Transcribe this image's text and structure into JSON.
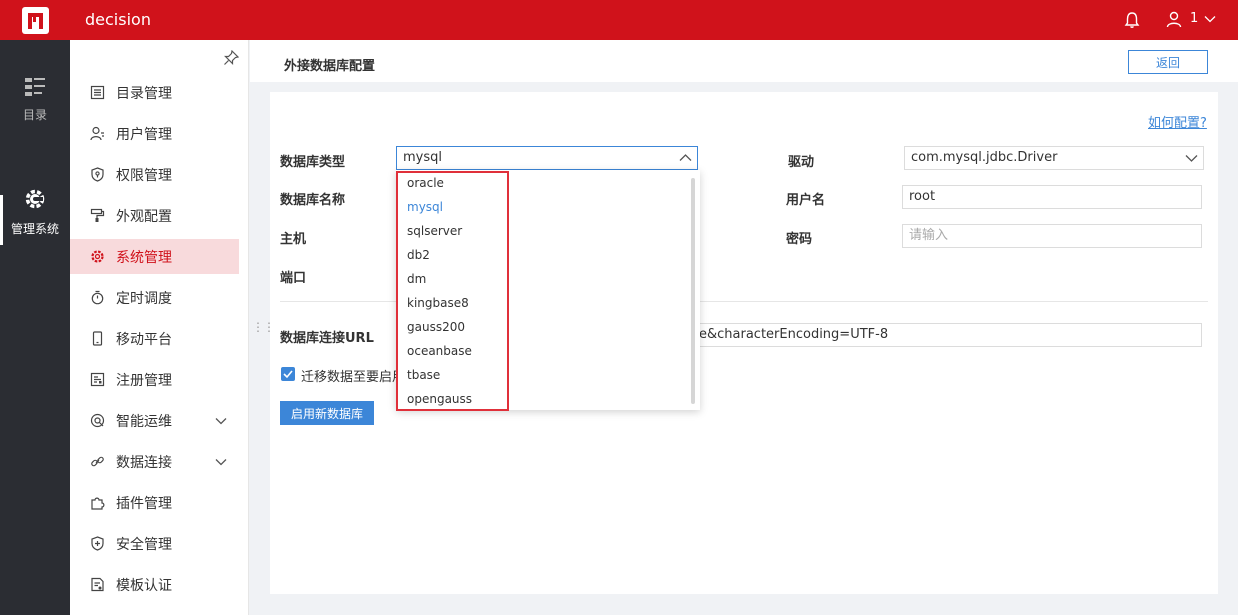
{
  "app": {
    "title": "decision",
    "user": "1"
  },
  "rail": {
    "directory": "目录",
    "system": "管理系统"
  },
  "sidebar": {
    "items": [
      {
        "label": "目录管理",
        "icon": "directory-list-icon"
      },
      {
        "label": "用户管理",
        "icon": "user-manage-icon"
      },
      {
        "label": "权限管理",
        "icon": "permission-shield-icon"
      },
      {
        "label": "外观配置",
        "icon": "paint-roller-icon"
      },
      {
        "label": "系统管理",
        "icon": "gear-icon",
        "active": true
      },
      {
        "label": "定时调度",
        "icon": "stopwatch-icon"
      },
      {
        "label": "移动平台",
        "icon": "mobile-icon"
      },
      {
        "label": "注册管理",
        "icon": "register-icon"
      },
      {
        "label": "智能运维",
        "icon": "ops-icon",
        "expandable": true
      },
      {
        "label": "数据连接",
        "icon": "link-icon",
        "expandable": true
      },
      {
        "label": "插件管理",
        "icon": "plugin-icon"
      },
      {
        "label": "安全管理",
        "icon": "security-shield-icon"
      },
      {
        "label": "模板认证",
        "icon": "template-cert-icon"
      }
    ]
  },
  "header": {
    "title": "外接数据库配置",
    "back_label": "返回"
  },
  "form": {
    "help_link": "如何配置?",
    "db_type_label": "数据库类型",
    "db_type_value": "mysql",
    "driver_label": "驱动",
    "driver_value": "com.mysql.jdbc.Driver",
    "db_name_label": "数据库名称",
    "username_label": "用户名",
    "username_value": "root",
    "host_label": "主机",
    "password_label": "密码",
    "password_placeholder": "请输入",
    "port_label": "端口",
    "url_label": "数据库连接URL",
    "url_value_visible": "e&characterEncoding=UTF-8",
    "migrate_label": "迁移数据至要启用",
    "migrate_checked": true,
    "enable_button": "启用新数据库"
  },
  "dropdown": {
    "options": [
      "oracle",
      "mysql",
      "sqlserver",
      "db2",
      "dm",
      "kingbase8",
      "gauss200",
      "oceanbase",
      "tbase",
      "opengauss"
    ],
    "selected": "mysql"
  },
  "colors": {
    "brand_red": "#d0121b",
    "accent_blue": "#3c86d8",
    "highlight_red": "#e0303a",
    "rail_dark": "#2b2d33"
  }
}
